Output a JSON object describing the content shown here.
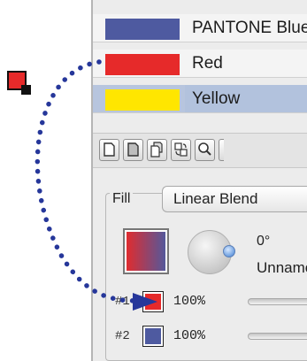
{
  "swatches": [
    {
      "label": "PANTONE Blue",
      "color": "#4e5aa0"
    },
    {
      "label": "Red",
      "color": "#e62a2a"
    },
    {
      "label": "Yellow",
      "color": "#ffe600"
    }
  ],
  "selected_swatch": "Yellow",
  "toolbar": {
    "buttons": [
      "new-document-icon",
      "document-icon",
      "duplicate-icon",
      "convert-icon",
      "magnifier-icon"
    ]
  },
  "fill": {
    "label": "Fill",
    "blend_type": "Linear Blend",
    "angle": "0°",
    "name": "Unnamed"
  },
  "stops": [
    {
      "index": "#1",
      "color": "#e62a2a",
      "percent": "100%"
    },
    {
      "index": "#2",
      "color": "#4e5aa0",
      "percent": "100%"
    }
  ],
  "drag_swatch_color": "#e62a2a",
  "arc_color": "#26379a"
}
